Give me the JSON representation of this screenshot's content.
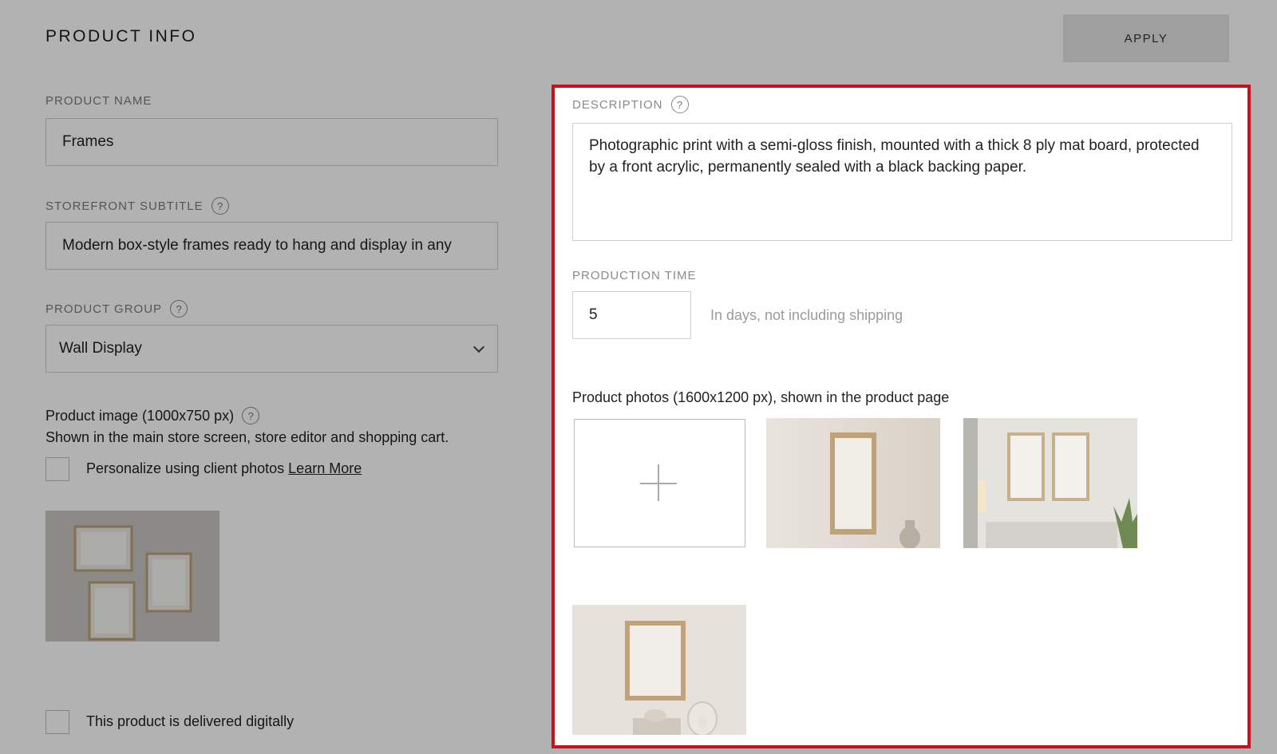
{
  "header": {
    "title": "PRODUCT INFO",
    "apply_label": "APPLY"
  },
  "product_name": {
    "label": "PRODUCT NAME",
    "value": "Frames"
  },
  "storefront_subtitle": {
    "label": "STOREFRONT SUBTITLE",
    "value": "Modern box-style frames ready to hang and display in any"
  },
  "product_group": {
    "label": "PRODUCT GROUP",
    "selected": "Wall Display"
  },
  "product_image": {
    "title": "Product image (1000x750 px)",
    "subtitle": "Shown in the main store screen, store editor and shopping cart."
  },
  "personalize": {
    "label": "Personalize using client photos",
    "link": "Learn More"
  },
  "digital": {
    "label": "This product is delivered digitally"
  },
  "description": {
    "label": "DESCRIPTION",
    "value": "Photographic print with a semi-gloss finish, mounted with a thick 8 ply mat board, protected by a front acrylic, permanently sealed with a black backing paper."
  },
  "production_time": {
    "label": "PRODUCTION TIME",
    "value": "5",
    "hint": "In days, not including shipping"
  },
  "product_photos": {
    "title": "Product photos (1600x1200 px), shown in the product page"
  },
  "help_glyph": "?",
  "colors": {
    "highlight_border": "#c8101e",
    "overlay": "rgba(0,0,0,0.30)"
  }
}
